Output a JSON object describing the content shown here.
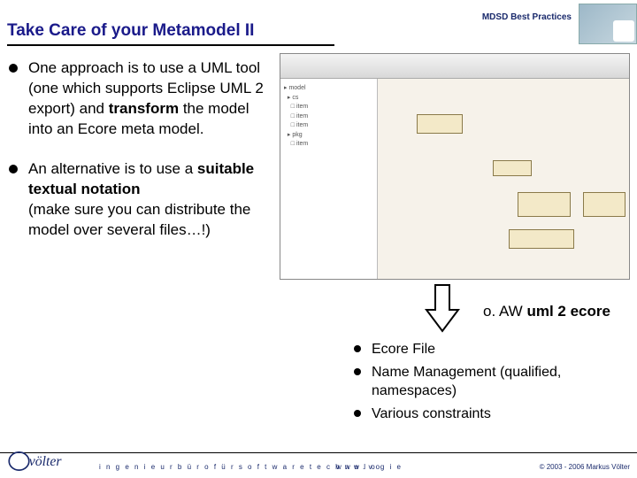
{
  "header": {
    "category": "MDSD Best Practices"
  },
  "title": "Take Care of your Metamodel II",
  "bullets_left": [
    {
      "prefix": "One approach is to use a UML tool (one which supports Eclipse UML 2 export) and ",
      "bold": "transform",
      "suffix": " the model into an Ecore meta model."
    },
    {
      "prefix": "An alternative is to use a ",
      "bold": "suitable textual notation",
      "suffix": "\n(make sure you can distribute the model over several files…!)"
    }
  ],
  "oaw_prefix": "o. AW ",
  "oaw_bold": "uml 2 ecore",
  "sub_bullets": [
    "Ecore File",
    "Name Management (qualified, namespaces)",
    "Various constraints"
  ],
  "footer": {
    "tagline": "i n g e n i e u r b ü r o   f ü r   s o f t w a r e t e c h n o l o g i e",
    "url": "w w w . v o",
    "copyright": "© 2003 - 2006 Markus Völter"
  },
  "brand": "völter"
}
